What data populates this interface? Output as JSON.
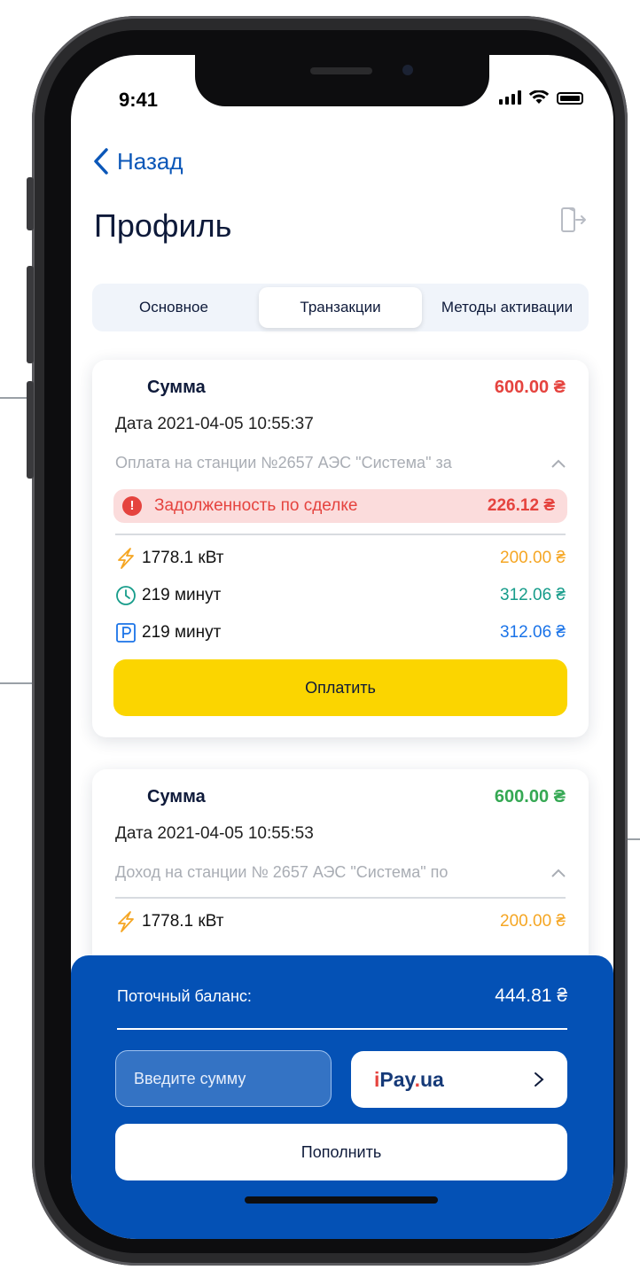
{
  "status": {
    "time": "9:41"
  },
  "nav": {
    "back_label": "Назад",
    "title": "Профиль"
  },
  "tabs": [
    {
      "label": "Основное",
      "active": false
    },
    {
      "label": "Транзакции",
      "active": true
    },
    {
      "label": "Методы активации",
      "active": false
    }
  ],
  "transactions": [
    {
      "sum_label": "Сумма",
      "amount": "600.00 ₴",
      "amount_color": "#e5433e",
      "date": "Дата 2021-04-05 10:55:37",
      "description": "Оплата на станции №2657 АЭС \"Система\" за",
      "debt": {
        "label": "Задолженность по сделке",
        "amount": "226.12 ₴"
      },
      "items": [
        {
          "icon": "lightning-icon",
          "label": "1778.1 кВт",
          "value": "200.00 ₴"
        },
        {
          "icon": "clock-icon",
          "label": "219 минут",
          "value": "312.06 ₴"
        },
        {
          "icon": "parking-icon",
          "label": "219 минут",
          "value": "312.06 ₴"
        }
      ],
      "pay_label": "Оплатить"
    },
    {
      "sum_label": "Сумма",
      "amount": "600.00 ₴",
      "amount_color": "#35a853",
      "date": "Дата 2021-04-05 10:55:53",
      "description": "Доход на станции № 2657 АЭС \"Система\" по",
      "items": [
        {
          "icon": "lightning-icon",
          "label": "1778.1 кВт",
          "value": "200.00 ₴"
        }
      ]
    }
  ],
  "balance": {
    "label": "Поточный баланс:",
    "value": "444.81 ₴",
    "input_placeholder": "Введите сумму",
    "payment_provider": {
      "i": "i",
      "pay": "Pay",
      "dot": ".",
      "ua": "ua"
    },
    "topup_label": "Пополнить"
  }
}
